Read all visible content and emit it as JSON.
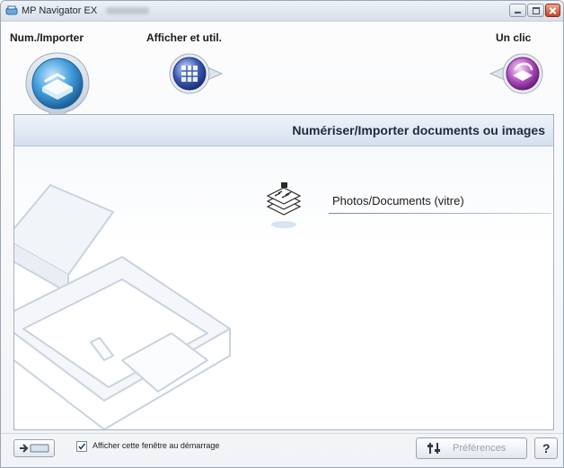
{
  "window": {
    "title": "MP Navigator EX"
  },
  "modes": {
    "scan_label": "Num./Importer",
    "view_label": "Afficher et util.",
    "oneclick_label": "Un clic"
  },
  "panel": {
    "title": "Numériser/Importer documents ou images",
    "item_label": "Photos/Documents (vitre)"
  },
  "footer": {
    "checkbox_label": "Afficher cette fenêtre au démarrage",
    "checkbox_checked": true,
    "preferences_label": "Préférences",
    "help_label": "?"
  },
  "icons": {
    "app": "scanner-app-icon",
    "scan_mode": "scan-import-icon",
    "view_mode": "view-use-icon",
    "oneclick_mode": "one-click-icon",
    "document": "documents-stack-icon",
    "navigation": "switch-arrow-icon",
    "preferences": "preferences-icon"
  },
  "colors": {
    "scan_accent": "#3f9ad8",
    "view_accent": "#3b5bb8",
    "oneclick_accent": "#b24fc0",
    "header_bg": "#d5e0ee"
  }
}
